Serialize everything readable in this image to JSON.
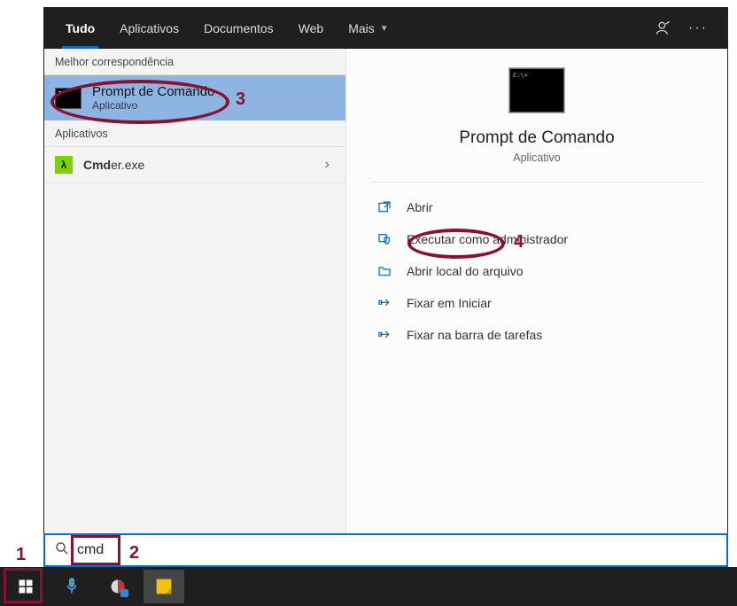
{
  "header": {
    "tabs": [
      "Tudo",
      "Aplicativos",
      "Documentos",
      "Web",
      "Mais"
    ],
    "active_index": 0
  },
  "left": {
    "best_match_label": "Melhor correspondência",
    "best_title": "Prompt de Comando",
    "best_sub": "Aplicativo",
    "apps_label": "Aplicativos",
    "apps_item_bold": "Cmd",
    "apps_item_rest": "er.exe"
  },
  "right": {
    "title": "Prompt de Comando",
    "sub": "Aplicativo",
    "actions": [
      "Abrir",
      "Executar como administrador",
      "Abrir local do arquivo",
      "Fixar em Iniciar",
      "Fixar na barra de tarefas"
    ]
  },
  "search": {
    "value": "cmd",
    "placeholder": ""
  },
  "markers": {
    "m1": "1",
    "m2": "2",
    "m3": "3",
    "m4": "4"
  }
}
